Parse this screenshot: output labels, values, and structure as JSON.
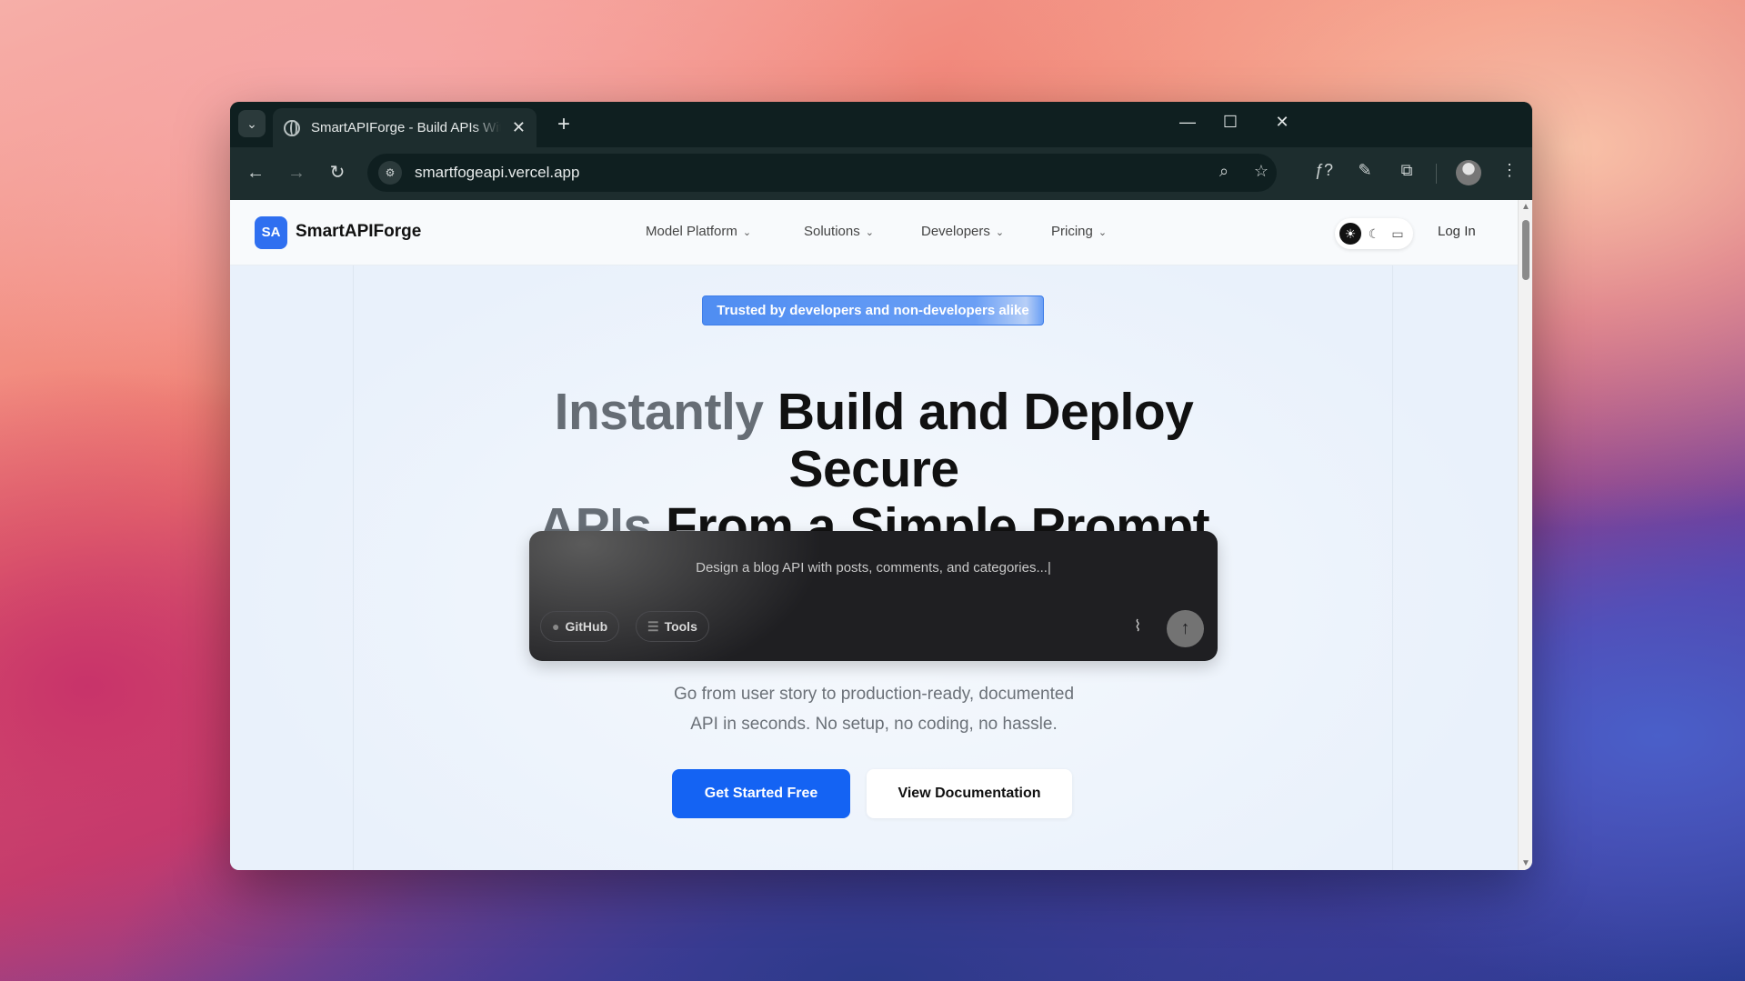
{
  "browser": {
    "tab_title": "SmartAPIForge - Build APIs With AI",
    "url": "smartfogeapi.vercel.app",
    "new_tab_label": "+",
    "tab_close": "✕",
    "tab_list": "⌄",
    "minimize": "—",
    "maximize": "☐",
    "close": "✕",
    "back": "←",
    "forward": "→",
    "reload": "↻",
    "site_info": "⚙",
    "zoom": "⌕",
    "bookmark": "☆",
    "ext_fx": "ƒ?",
    "ext_pen": "✎",
    "extensions": "⧉",
    "menu": "⋮"
  },
  "site": {
    "logo_badge": "SA",
    "logo_text": "SmartAPIForge",
    "nav": [
      {
        "label": "Model Platform",
        "chevron": "⌄"
      },
      {
        "label": "Solutions",
        "chevron": "⌄"
      },
      {
        "label": "Developers",
        "chevron": "⌄"
      },
      {
        "label": "Pricing",
        "chevron": "⌄"
      }
    ],
    "theme": {
      "light": "☀",
      "dark": "☾",
      "system": "▭"
    },
    "login": "Log In"
  },
  "hero": {
    "badge": "Trusted by developers and non-developers alike",
    "headline_part1_muted": "Instantly",
    "headline_part1": " Build and Deploy Secure",
    "headline_part2_muted": "APIs",
    "headline_part2": " From a Simple Prompt",
    "prompt_placeholder": "Design a blog API with posts, comments, and categories...|",
    "github_label": "GitHub",
    "github_icon": "●",
    "tools_label": "Tools",
    "tools_icon": "☰",
    "attach_icon": "⌇",
    "send_icon": "↑",
    "subtext_line1": "Go from user story to production-ready, documented",
    "subtext_line2": "API in seconds. No setup, no coding, no hassle.",
    "cta_primary": "Get Started Free",
    "cta_secondary": "View Documentation"
  },
  "scrollbar": {
    "up": "▲",
    "down": "▼"
  }
}
